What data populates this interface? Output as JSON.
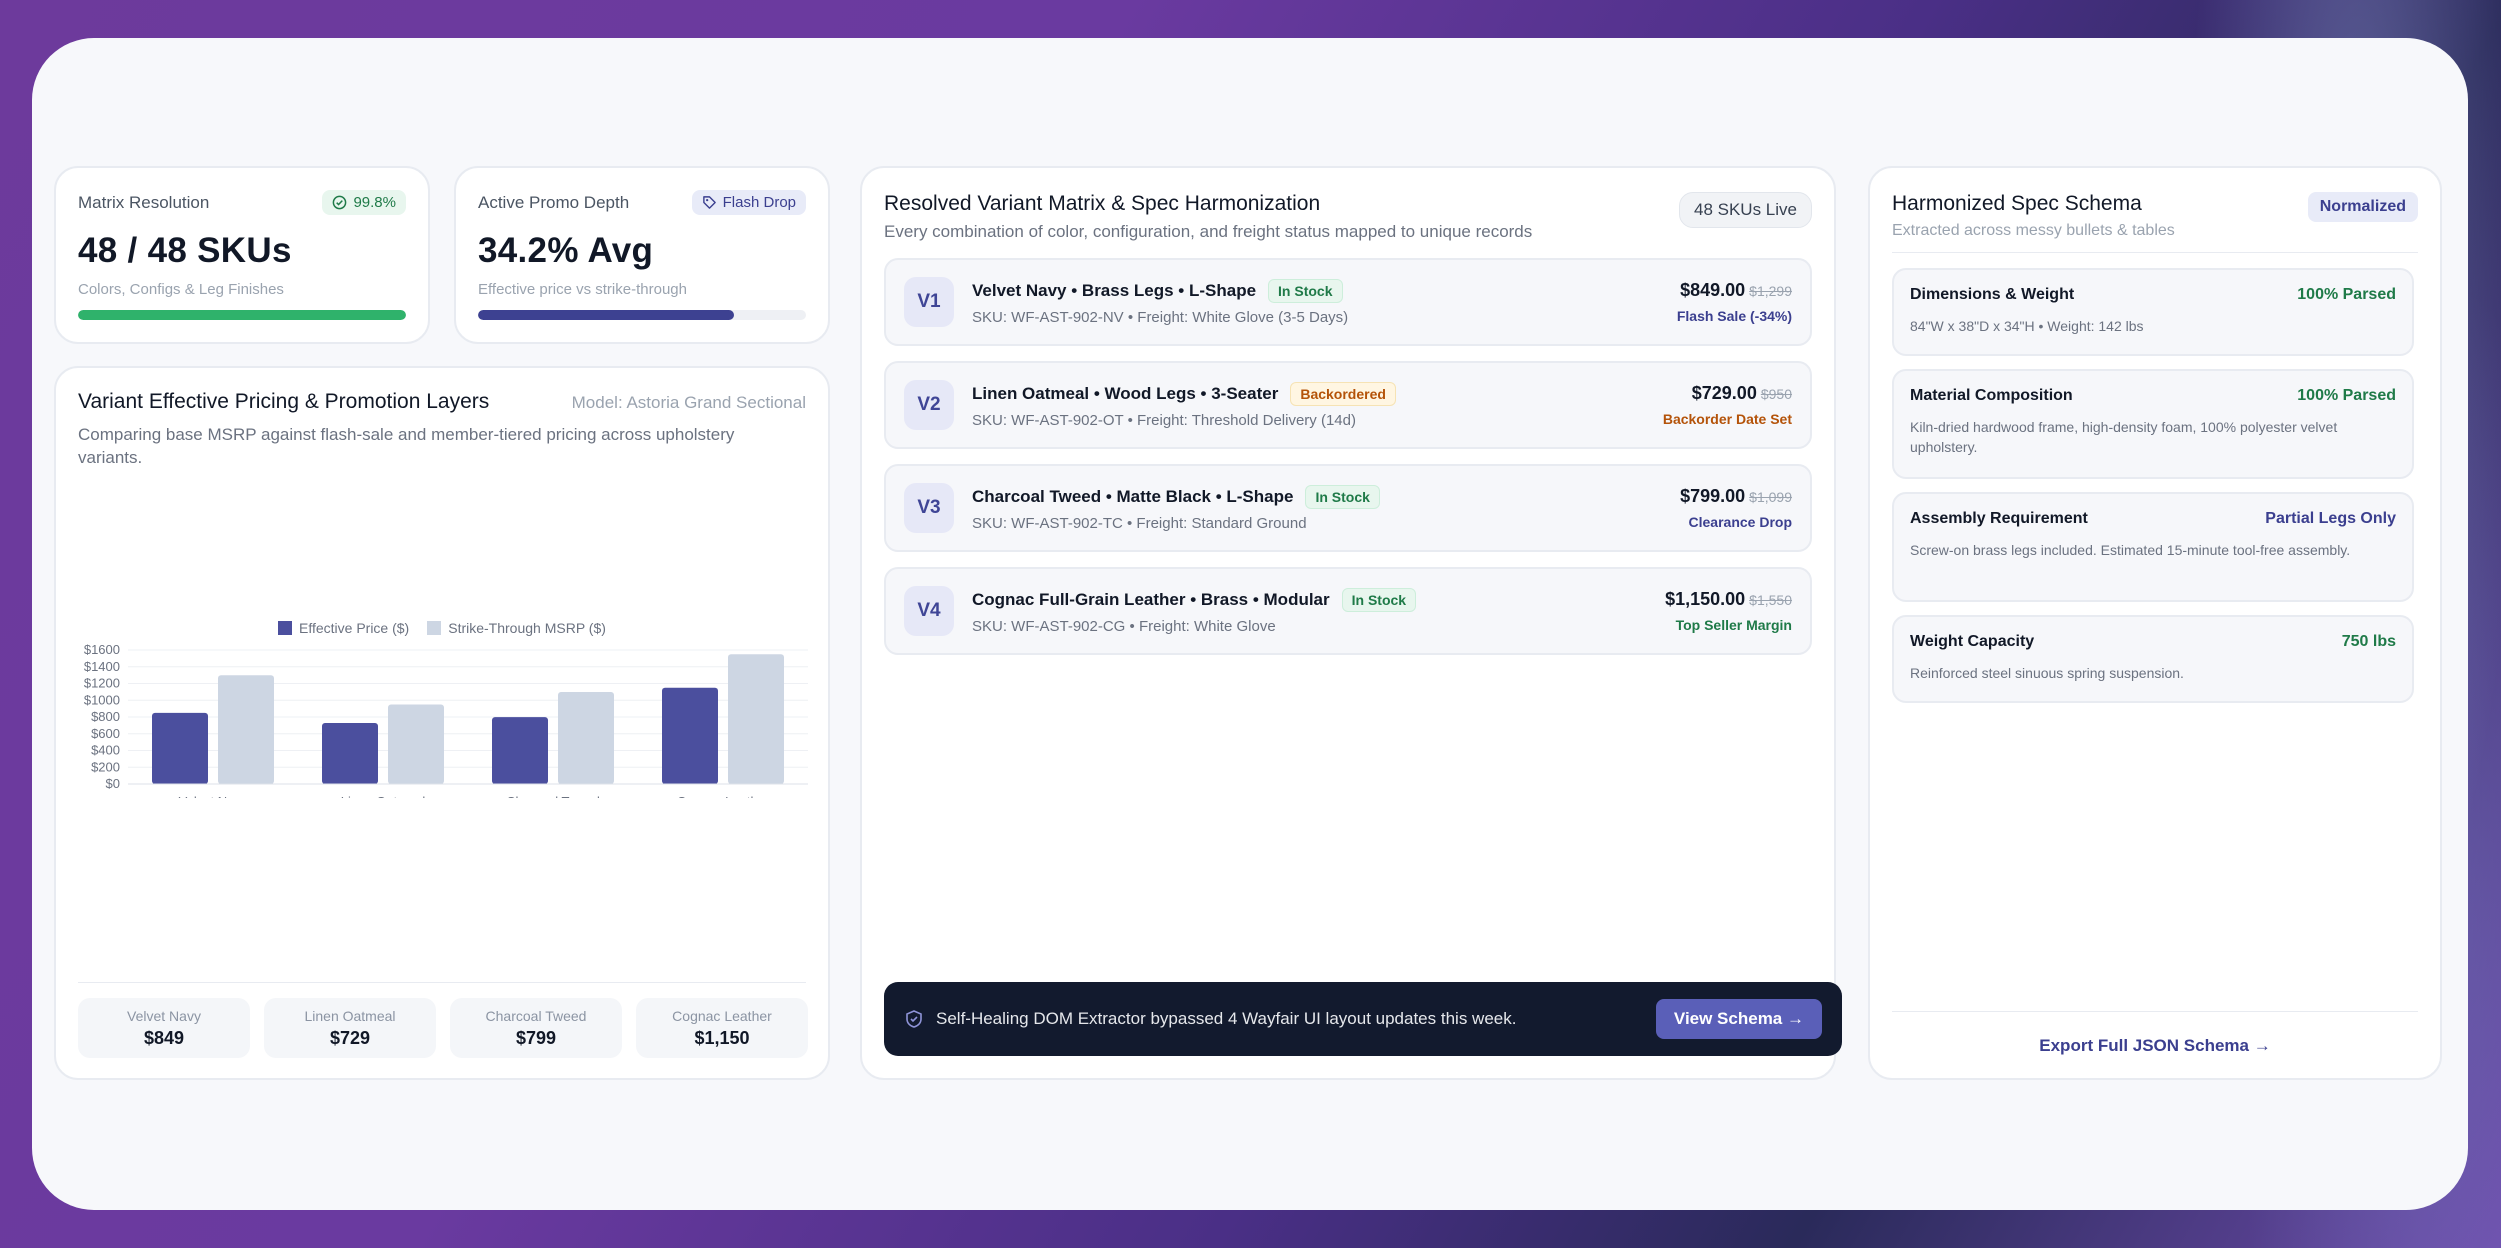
{
  "colors": {
    "indigo": "#4b4f9e",
    "grey_bar": "#cdd6e3",
    "green": "#1f7a48",
    "amber": "#b45309",
    "progress_green": "#2fb26b",
    "progress_indigo": "#3d4191"
  },
  "kpis": [
    {
      "label": "Matrix Resolution",
      "badge": "99.8%",
      "badge_icon": "check-circle-icon",
      "value": "48 / 48 SKUs",
      "sub": "Colors, Configs & Leg Finishes",
      "progress": 1.0
    },
    {
      "label": "Active Promo Depth",
      "badge": "Flash Drop",
      "badge_icon": "tag-icon",
      "value": "34.2% Avg",
      "sub": "Effective price vs strike-through",
      "progress": 0.78
    }
  ],
  "pricing": {
    "title": "Variant Effective Pricing & Promotion Layers",
    "model": "Model: Astoria Grand Sectional",
    "description": "Comparing base MSRP against flash-sale and member-tiered pricing across upholstery variants."
  },
  "chart_data": {
    "type": "bar",
    "categories": [
      "Velvet Navy",
      "Linen Oatmeal",
      "Charcoal Tweed",
      "Cognac Leather"
    ],
    "series": [
      {
        "name": "Effective Price ($)",
        "values": [
          849,
          729,
          799,
          1150
        ]
      },
      {
        "name": "Strike-Through MSRP ($)",
        "values": [
          1299,
          950,
          1099,
          1550
        ]
      }
    ],
    "ylim": [
      0,
      1600
    ],
    "yticks": [
      "$0",
      "$200",
      "$400",
      "$600",
      "$800",
      "$1000",
      "$1200",
      "$1400",
      "$1600"
    ],
    "grid": true,
    "legend": "top-center"
  },
  "mini_stats": [
    {
      "name": "Velvet Navy",
      "value": "$849"
    },
    {
      "name": "Linen Oatmeal",
      "value": "$729"
    },
    {
      "name": "Charcoal Tweed",
      "value": "$799"
    },
    {
      "name": "Cognac Leather",
      "value": "$1,150"
    }
  ],
  "matrix": {
    "title": "Resolved Variant Matrix & Spec Harmonization",
    "subtitle": "Every combination of color, configuration, and freight status mapped to unique records",
    "badge": "48 SKUs Live",
    "variants": [
      {
        "tag": "V1",
        "name": "Velvet Navy • Brass Legs • L-Shape",
        "status": "In Stock",
        "status_kind": "in",
        "sku": "SKU: WF-AST-902-NV • Freight: White Glove (3-5 Days)",
        "price": "$849.00",
        "strike": "$1,299",
        "note": "Flash Sale (-34%)",
        "note_color": "#3b3f8f"
      },
      {
        "tag": "V2",
        "name": "Linen Oatmeal • Wood Legs • 3-Seater",
        "status": "Backordered",
        "status_kind": "back",
        "sku": "SKU: WF-AST-902-OT • Freight: Threshold Delivery (14d)",
        "price": "$729.00",
        "strike": "$950",
        "note": "Backorder Date Set",
        "note_color": "#b45309"
      },
      {
        "tag": "V3",
        "name": "Charcoal Tweed • Matte Black • L-Shape",
        "status": "In Stock",
        "status_kind": "in",
        "sku": "SKU: WF-AST-902-TC • Freight: Standard Ground",
        "price": "$799.00",
        "strike": "$1,099",
        "note": "Clearance Drop",
        "note_color": "#3b3f8f"
      },
      {
        "tag": "V4",
        "name": "Cognac Full-Grain Leather • Brass • Modular",
        "status": "In Stock",
        "status_kind": "in",
        "sku": "SKU: WF-AST-902-CG • Freight: White Glove",
        "price": "$1,150.00",
        "strike": "$1,550",
        "note": "Top Seller Margin",
        "note_color": "#1f7a48"
      }
    ],
    "banner_text": "Self-Healing DOM Extractor bypassed 4 Wayfair UI layout updates this week.",
    "banner_button": "View Schema →"
  },
  "spec": {
    "title": "Harmonized Spec Schema",
    "subtitle": "Extracted across messy bullets & tables",
    "badge": "Normalized",
    "rows": [
      {
        "name": "Dimensions & Weight",
        "value": "100% Parsed",
        "value_color": "#1f7a48",
        "desc": "84\"W x 38\"D x 34\"H • Weight: 142 lbs"
      },
      {
        "name": "Material Composition",
        "value": "100% Parsed",
        "value_color": "#1f7a48",
        "desc": "Kiln-dried hardwood frame, high-density foam, 100% polyester velvet upholstery."
      },
      {
        "name": "Assembly Requirement",
        "value": "Partial Legs Only",
        "value_color": "#3b3f8f",
        "desc": "Screw-on brass legs included. Estimated 15-minute tool-free assembly."
      },
      {
        "name": "Weight Capacity",
        "value": "750 lbs",
        "value_color": "#1f7a48",
        "desc": "Reinforced steel sinuous spring suspension."
      }
    ],
    "export_label": "Export Full JSON Schema →"
  }
}
